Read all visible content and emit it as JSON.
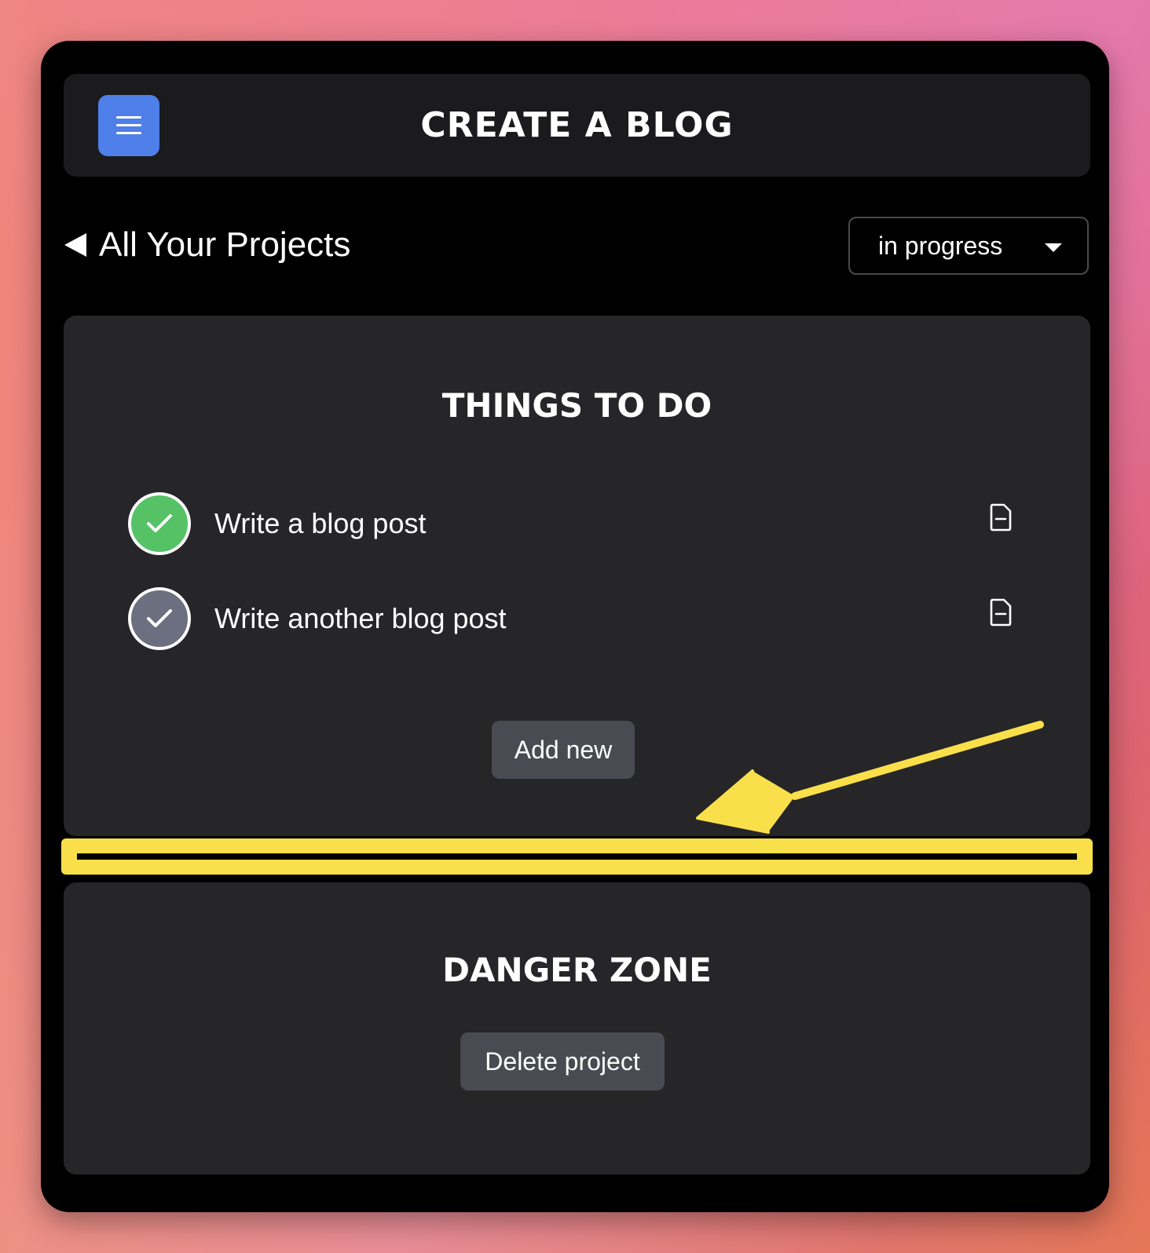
{
  "header": {
    "title": "CREATE A BLOG",
    "menu_icon": "hamburger-menu-icon",
    "menu_color": "#4f7fe8"
  },
  "nav": {
    "back_label": "All Your Projects",
    "back_icon": "back-triangle-icon"
  },
  "status_select": {
    "value": "in progress",
    "icon": "caret-down-icon"
  },
  "todo": {
    "title": "THINGS TO DO",
    "tasks": [
      {
        "label": "Write a blog post",
        "done": true,
        "status_color": "#55c266",
        "icon": "document-icon"
      },
      {
        "label": "Write another blog post",
        "done": false,
        "status_color": "#6c6f7f",
        "icon": "document-icon"
      }
    ],
    "add_label": "Add new"
  },
  "danger": {
    "title": "DANGER ZONE",
    "delete_label": "Delete project"
  },
  "annotation": {
    "highlight_color": "#f9e04a",
    "arrow_icon": "annotation-arrow-icon"
  }
}
